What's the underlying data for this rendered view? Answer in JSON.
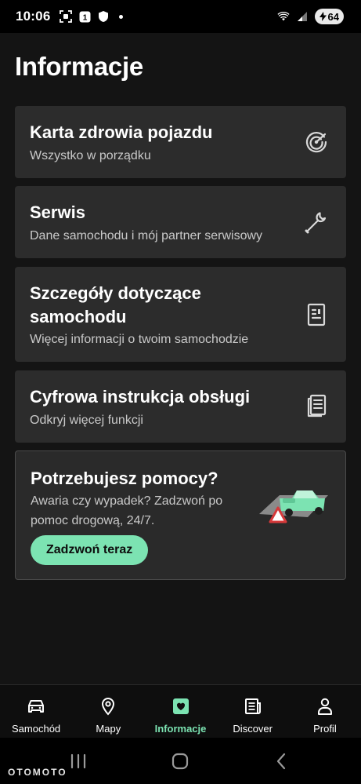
{
  "status_bar": {
    "time": "10:06",
    "battery": "64",
    "icons": [
      "screenshot-icon",
      "notification-badge-icon",
      "shield-icon",
      "dot-icon",
      "wifi-icon",
      "signal-icon",
      "battery-icon"
    ]
  },
  "page": {
    "title": "Informacje"
  },
  "cards": [
    {
      "title": "Karta zdrowia pojazdu",
      "subtitle": "Wszystko w porządku",
      "icon": "health-gauge-icon"
    },
    {
      "title": "Serwis",
      "subtitle": "Dane samochodu i mój partner serwisowy",
      "icon": "wrench-icon"
    },
    {
      "title_line1": "Szczegóły dotyczące",
      "title_line2": "samochodu",
      "subtitle": "Więcej informacji o twoim samochodzie",
      "icon": "document-icon"
    },
    {
      "title": "Cyfrowa instrukcja obsługi",
      "subtitle": "Odkryj więcej funkcji",
      "icon": "manual-book-icon"
    }
  ],
  "help": {
    "title": "Potrzebujesz pomocy?",
    "text": "Awaria czy wypadek? Zadzwoń po pomoc drogową, 24/7.",
    "button": "Zadzwoń teraz",
    "illustration": "car-warning-triangle-illustration"
  },
  "bottom_nav": {
    "items": [
      {
        "label": "Samochód",
        "icon": "car-icon"
      },
      {
        "label": "Mapy",
        "icon": "map-pin-icon"
      },
      {
        "label": "Informacje",
        "icon": "info-heart-icon",
        "active": true
      },
      {
        "label": "Discover",
        "icon": "newspaper-icon"
      },
      {
        "label": "Profil",
        "icon": "person-icon"
      }
    ]
  },
  "watermark": "OTOMOTO",
  "colors": {
    "background": "#141414",
    "card": "#2c2c2c",
    "accent": "#7ce3b2",
    "subtext": "#c9c9c9"
  }
}
